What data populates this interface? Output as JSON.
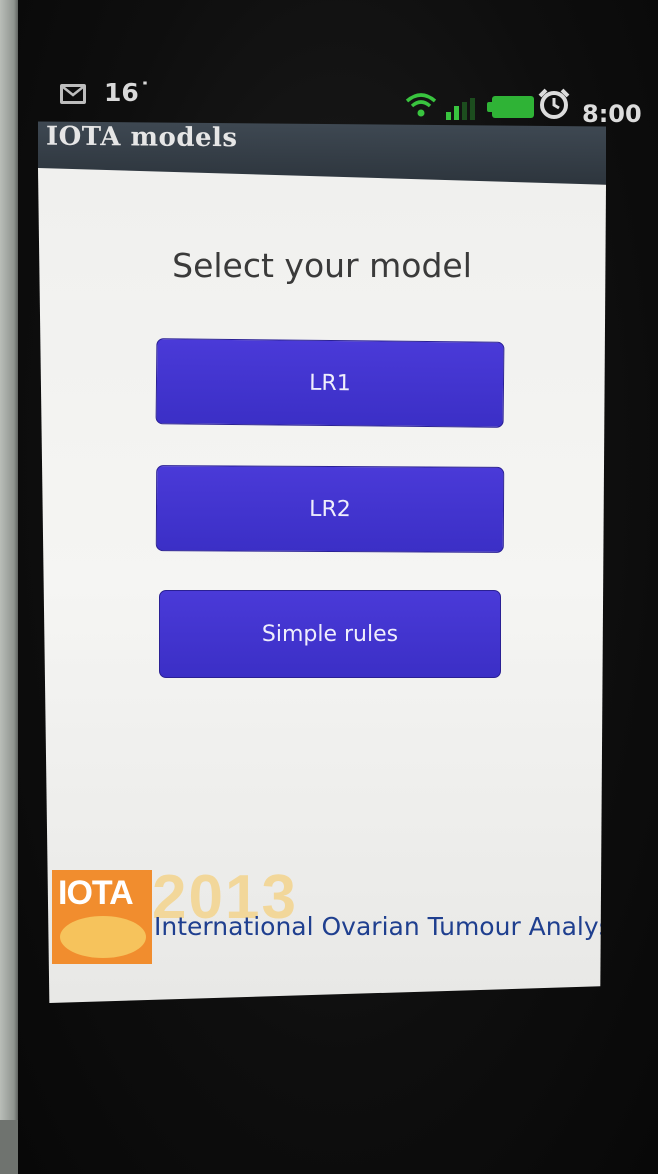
{
  "status_bar": {
    "temperature": "16˙",
    "time": "8:00",
    "icons": [
      "mail-icon",
      "wifi-icon",
      "signal-icon",
      "battery-icon",
      "alarm-icon"
    ]
  },
  "app": {
    "title": "IOTA models"
  },
  "main": {
    "heading": "Select your model",
    "buttons": [
      {
        "label": "LR1"
      },
      {
        "label": "LR2"
      },
      {
        "label": "Simple rules"
      }
    ]
  },
  "logo": {
    "badge": "IOTA",
    "year": "2013",
    "tagline": "International Ovarian Tumour Analysis"
  },
  "colors": {
    "button": "#3f33cc",
    "titlebar": "#343d46",
    "logo_orange": "#f18d2e",
    "logo_blue": "#1f3f8f"
  }
}
